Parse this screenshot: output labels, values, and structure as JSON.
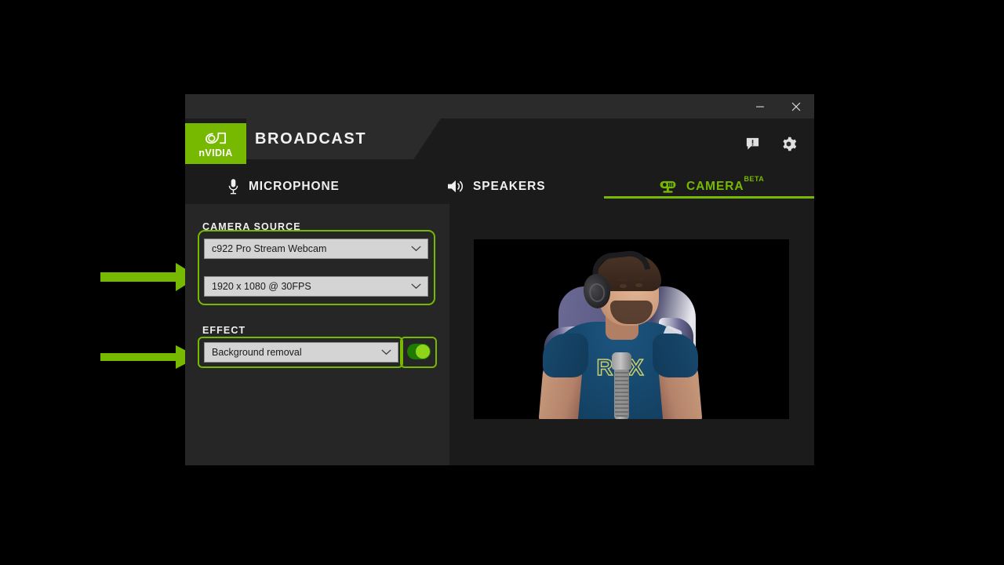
{
  "app": {
    "brand_name": "nVIDIA",
    "title": "BROADCAST",
    "accent_color": "#76b900",
    "window_bg": "#1b1b1b",
    "panel_bg": "#262626"
  },
  "titlebar": {
    "minimize_label": "Minimize",
    "close_label": "Close",
    "minimize_icon": "minimize-icon",
    "close_icon": "close-icon"
  },
  "header": {
    "feedback_icon": "feedback-icon",
    "feedback_label": "Send feedback",
    "settings_icon": "gear-icon",
    "settings_label": "Settings"
  },
  "tabs": [
    {
      "id": "microphone",
      "label": "MICROPHONE",
      "icon": "microphone-icon",
      "active": false,
      "badge": ""
    },
    {
      "id": "speakers",
      "label": "SPEAKERS",
      "icon": "speaker-icon",
      "active": false,
      "badge": ""
    },
    {
      "id": "camera",
      "label": "CAMERA",
      "icon": "webcam-icon",
      "active": true,
      "badge": "BETA"
    }
  ],
  "left_panel": {
    "camera_source": {
      "section_label": "CAMERA SOURCE",
      "device_value": "c922 Pro Stream Webcam",
      "resolution_value": "1920 x 1080 @ 30FPS",
      "chevron_icon": "chevron-down-icon"
    },
    "effect": {
      "section_label": "EFFECT",
      "effect_value": "Background removal",
      "chevron_icon": "chevron-down-icon",
      "toggle_state": "on",
      "toggle_label": "Effect enabled"
    }
  },
  "preview": {
    "label": "Camera preview",
    "description": "Person wearing headphones and a blue RTX t-shirt seated in a purple gaming chair behind a microphone, background removed to black",
    "shirt_text": "RTX"
  },
  "annotations": [
    {
      "id": "arrow-camera-source",
      "type": "arrow",
      "direction": "right",
      "color": "#76b900",
      "points_to": "camera-source-group"
    },
    {
      "id": "arrow-effect",
      "type": "arrow",
      "direction": "right",
      "color": "#76b900",
      "points_to": "effect-dropdown"
    },
    {
      "id": "highlight-camera-source",
      "type": "box",
      "color": "#76b900",
      "target": "camera-source-group"
    },
    {
      "id": "highlight-effect",
      "type": "box",
      "color": "#76b900",
      "target": "effect-dropdown"
    },
    {
      "id": "highlight-toggle",
      "type": "box",
      "color": "#76b900",
      "target": "effect-toggle"
    }
  ]
}
